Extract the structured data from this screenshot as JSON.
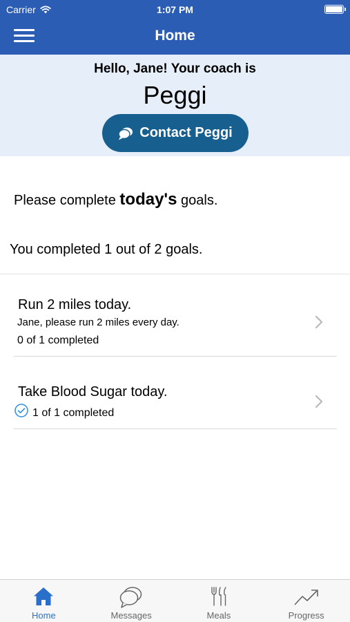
{
  "status_bar": {
    "carrier": "Carrier",
    "time": "1:07 PM"
  },
  "nav": {
    "title": "Home"
  },
  "coach": {
    "greeting": "Hello, Jane! Your coach is",
    "name": "Peggi",
    "contact_label": "Contact Peggi"
  },
  "prompt": {
    "before": "Please complete ",
    "emphasis": "today's",
    "after": " goals."
  },
  "summary": "You completed 1 out of 2 goals.",
  "goals": [
    {
      "title": "Run 2 miles today.",
      "description": "Jane, please run 2 miles every day.",
      "progress": "0 of 1 completed",
      "completed": false
    },
    {
      "title": "Take Blood Sugar today.",
      "progress": "1 of 1 completed",
      "completed": true
    }
  ],
  "tabs": [
    {
      "label": "Home",
      "icon": "home-icon",
      "active": true
    },
    {
      "label": "Messages",
      "icon": "messages-icon",
      "active": false
    },
    {
      "label": "Meals",
      "icon": "meals-icon",
      "active": false
    },
    {
      "label": "Progress",
      "icon": "progress-icon",
      "active": false
    }
  ],
  "colors": {
    "header": "#2a5db3",
    "banner": "#e6eff9",
    "button": "#175f8f",
    "tab_active": "#2a6fc9"
  }
}
